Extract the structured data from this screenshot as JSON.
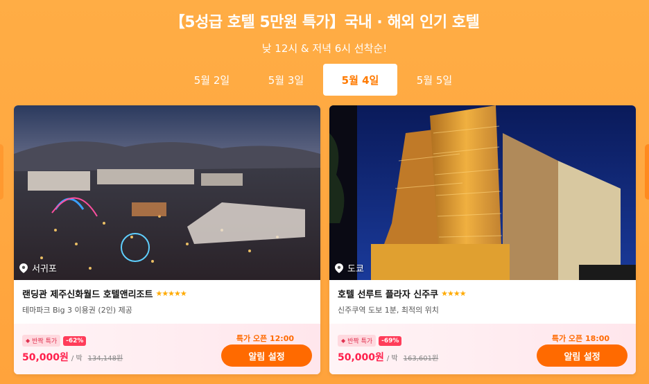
{
  "header": {
    "title": "【5성급 호텔 5만원 특가】국내 · 해외 인기 호텔",
    "subtitle": "낮 12시 & 저녁 6시 선착순!"
  },
  "tabs": [
    {
      "label": "5월 2일",
      "active": false
    },
    {
      "label": "5월 3일",
      "active": false
    },
    {
      "label": "5월 4일",
      "active": true
    },
    {
      "label": "5월 5일",
      "active": false
    }
  ],
  "cards": [
    {
      "location": "서귀포",
      "name": "랜딩관 제주신화월드 호텔앤리조트",
      "stars": "★★★★★",
      "desc": "테마파크 Big 3 이용권 (2인) 제공",
      "tag": "반짝 특가",
      "discount": "-62%",
      "price": "50,000원",
      "unit": "/ 박",
      "orig_price": "134,148원",
      "open_time": "특가 오픈 12:00",
      "button": "알림 설정"
    },
    {
      "location": "도쿄",
      "name": "호텔 선루트 플라자 신주쿠",
      "stars": "★★★★",
      "desc": "신주쿠역 도보 1분, 최적의 위치",
      "tag": "반짝 특가",
      "discount": "-69%",
      "price": "50,000원",
      "unit": "/ 박",
      "orig_price": "163,601원",
      "open_time": "특가 오픈 18:00",
      "button": "알림 설정"
    }
  ],
  "colors": {
    "background": "#ffa840",
    "accent": "#ff6a00",
    "price": "#ff1f4b"
  }
}
